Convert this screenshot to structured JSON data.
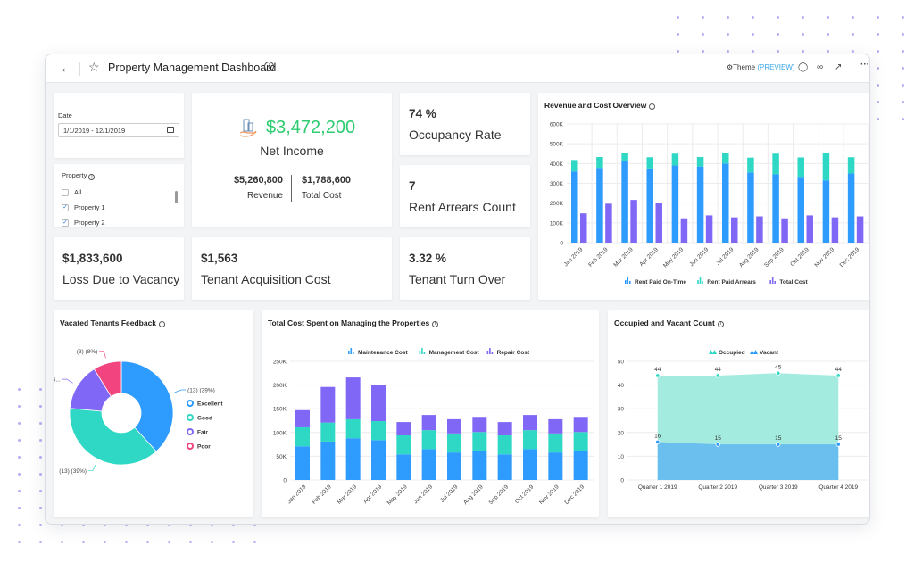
{
  "window": {
    "title": "Property Management Dashboard",
    "theme_label": "Theme",
    "theme_badge": "(PREVIEW)",
    "icons": [
      "back-arrow-icon",
      "star-icon",
      "info-icon",
      "gear-icon",
      "comment-icon",
      "glasses-icon",
      "expand-icon",
      "more-icon"
    ]
  },
  "filters": {
    "date_label": "Date",
    "date_value": "1/1/2019 - 12/1/2019",
    "property_label": "Property",
    "property_options": [
      {
        "label": "All",
        "checked": false
      },
      {
        "label": "Property 1",
        "checked": true
      },
      {
        "label": "Property 2",
        "checked": true
      }
    ]
  },
  "net_income": {
    "value": "$3,472,200",
    "label": "Net Income",
    "value_color": "#2ecc71",
    "revenue_value": "$5,260,800",
    "revenue_label": "Revenue",
    "cost_value": "$1,788,600",
    "cost_label": "Total Cost"
  },
  "kpis": {
    "occupancy": {
      "value": "74 %",
      "label": "Occupancy Rate"
    },
    "arrears": {
      "value": "7",
      "label": "Rent Arrears Count"
    },
    "vacancy_loss": {
      "value": "$1,833,600",
      "label": "Loss Due to Vacancy"
    },
    "acquisition": {
      "value": "$1,563",
      "label": "Tenant Acquisition Cost"
    },
    "turnover": {
      "value": "3.32 %",
      "label": "Tenant Turn Over"
    }
  },
  "chart_data": [
    {
      "id": "revenue_cost",
      "type": "bar",
      "title": "Revenue and Cost Overview",
      "categories": [
        "Jan 2019",
        "Feb 2019",
        "Mar 2019",
        "Apr 2019",
        "May 2019",
        "Jun 2019",
        "Jul 2019",
        "Aug 2019",
        "Sep 2019",
        "Oct 2019",
        "Nov 2019",
        "Dec 2019"
      ],
      "stacked_series": [
        {
          "name": "Rent Paid On-Time",
          "color": "#2e9bff",
          "values": [
            360000,
            378000,
            415000,
            375000,
            390000,
            385000,
            400000,
            355000,
            345000,
            333000,
            315000,
            350000
          ]
        },
        {
          "name": "Rent Paid Arrears",
          "color": "#2fd8c4",
          "values": [
            58000,
            55000,
            38000,
            57000,
            60000,
            48000,
            52000,
            75000,
            105000,
            98000,
            138000,
            82000
          ]
        }
      ],
      "side_series": {
        "name": "Total Cost",
        "color": "#8167f5",
        "values": [
          148000,
          197000,
          216000,
          201000,
          123000,
          138000,
          128000,
          133000,
          123000,
          138000,
          128000,
          133000
        ]
      },
      "ylim": [
        0,
        600000
      ],
      "yticks": [
        "0",
        "100K",
        "200K",
        "300K",
        "400K",
        "500K",
        "600K"
      ],
      "legend": "bottom"
    },
    {
      "id": "feedback",
      "type": "pie",
      "title": "Vacated Tenants Feedback",
      "slices": [
        {
          "name": "Excellent",
          "value": 13,
          "label": "(13) (39%)",
          "color": "#2e9bff"
        },
        {
          "name": "Good",
          "value": 13,
          "label": "(13) (39%)",
          "color": "#2fd8c4"
        },
        {
          "name": "Fair",
          "value": 5,
          "label": "(5...",
          "color": "#8167f5"
        },
        {
          "name": "Poor",
          "value": 3,
          "label": "(3) (8%)",
          "color": "#f2457f"
        }
      ],
      "legend": "right"
    },
    {
      "id": "management_cost",
      "type": "bar",
      "title": "Total Cost Spent on Managing the Properties",
      "categories": [
        "Jan 2019",
        "Feb 2019",
        "Mar 2019",
        "Apr 2019",
        "May 2019",
        "Jun 2019",
        "Jul 2019",
        "Aug 2019",
        "Sep 2019",
        "Oct 2019",
        "Nov 2019",
        "Dec 2019"
      ],
      "series": [
        {
          "name": "Maintenance Cost",
          "color": "#2e9bff",
          "values": [
            71000,
            81000,
            88000,
            84000,
            54000,
            65000,
            58000,
            61000,
            54000,
            65000,
            58000,
            61000
          ]
        },
        {
          "name": "Management Cost",
          "color": "#2fd8c4",
          "values": [
            40000,
            40000,
            40000,
            40000,
            40000,
            40000,
            40000,
            40000,
            40000,
            40000,
            40000,
            40000
          ]
        },
        {
          "name": "Repair Cost",
          "color": "#8167f5",
          "values": [
            36000,
            75000,
            88000,
            76000,
            28000,
            32000,
            30000,
            32000,
            28000,
            32000,
            30000,
            32000
          ]
        }
      ],
      "ylim": [
        0,
        250000
      ],
      "yticks": [
        "0",
        "50K",
        "100K",
        "150K",
        "200K",
        "250K"
      ],
      "legend": "top"
    },
    {
      "id": "occupied_vacant",
      "type": "area",
      "title": "Occupied and Vacant Count",
      "categories": [
        "Quarter 1 2019",
        "Quarter 2 2019",
        "Quarter 3 2019",
        "Quarter 4 2019"
      ],
      "series": [
        {
          "name": "Occupied",
          "color": "#2fd8c4",
          "values": [
            44,
            44,
            45,
            44
          ]
        },
        {
          "name": "Vacant",
          "color": "#2e9bff",
          "values": [
            16,
            15,
            15,
            15
          ]
        }
      ],
      "ylim": [
        0,
        50
      ],
      "yticks": [
        "0",
        "10",
        "20",
        "30",
        "40",
        "50"
      ],
      "legend": "top"
    }
  ]
}
